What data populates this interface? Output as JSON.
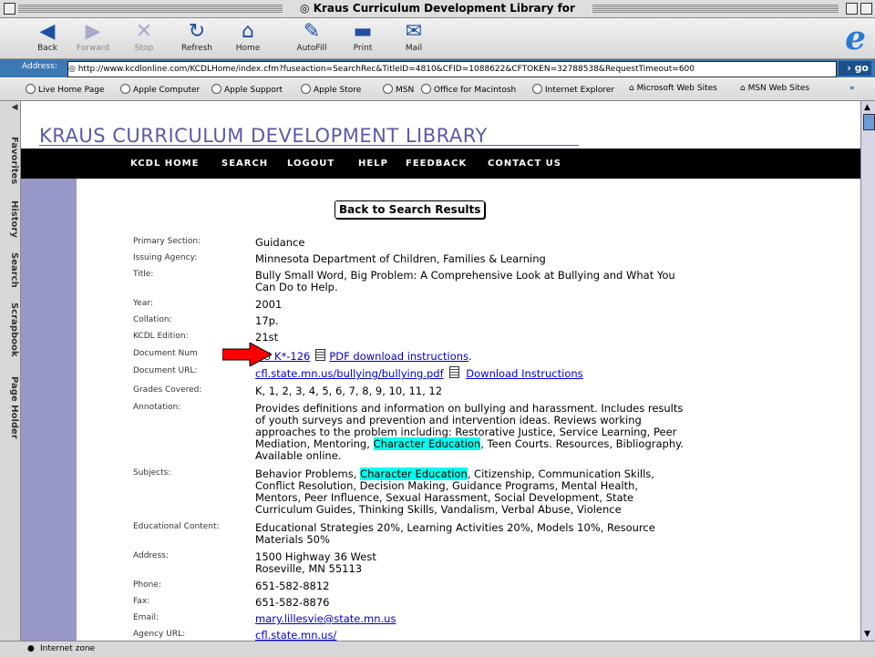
{
  "window": {
    "title": "Kraus Curriculum Development Library for educ..."
  },
  "toolbar": {
    "buttons": [
      {
        "label": "Back",
        "icon": "back-arrow-icon"
      },
      {
        "label": "Forward",
        "icon": "forward-arrow-icon"
      },
      {
        "label": "Stop",
        "icon": "stop-icon"
      },
      {
        "label": "Refresh",
        "icon": "refresh-icon"
      },
      {
        "label": "Home",
        "icon": "home-icon"
      },
      {
        "label": "AutoFill",
        "icon": "autofill-icon"
      },
      {
        "label": "Print",
        "icon": "print-icon"
      },
      {
        "label": "Mail",
        "icon": "mail-icon"
      }
    ]
  },
  "address": {
    "label": "Address:",
    "url": "http://www.kcdlonline.com/KCDLHome/index.cfm?fuseaction=SearchRec&TitleID=4810&CFID=1088622&CFTOKEN=32788538&RequestTimeout=600",
    "go_label": "go"
  },
  "favorites": [
    "Live Home Page",
    "Apple Computer",
    "Apple Support",
    "Apple Store",
    "MSN",
    "Office for Macintosh",
    "Internet Explorer",
    "Microsoft Web Sites",
    "MSN Web Sites"
  ],
  "sidetabs": [
    "Favorites",
    "History",
    "Search",
    "Scrapbook",
    "Page Holder"
  ],
  "status": {
    "text": "Internet zone"
  },
  "page": {
    "brand": "KRAUS CURRICULUM DEVELOPMENT LIBRARY",
    "nav": [
      "KCDL HOME",
      "SEARCH",
      "LOGOUT",
      "HELP",
      "FEEDBACK",
      "CONTACT US"
    ],
    "back_button": "Back to Search Results",
    "record": {
      "primary_section": {
        "label": "Primary Section:",
        "value": "Guidance"
      },
      "issuing_agency": {
        "label": "Issuing Agency:",
        "value": "Minnesota Department of Children, Families & Learning"
      },
      "title": {
        "label": "Title:",
        "value": "Bully Small Word, Big Problem: A Comprehensive Look at Bullying and What You Can Do to Help."
      },
      "year": {
        "label": "Year:",
        "value": "2001"
      },
      "collation": {
        "label": "Collation:",
        "value": "17p."
      },
      "edition": {
        "label": "KCDL Edition:",
        "value": "21st"
      },
      "document_number": {
        "label": "Document Num",
        "value": "GU K*-126",
        "instructions": "PDF download instructions",
        "trailing": "."
      },
      "document_url": {
        "label": "Document URL:",
        "value": "cfl.state.mn.us/bullying/bullying.pdf",
        "instructions": "Download Instructions"
      },
      "grades": {
        "label": "Grades Covered:",
        "value": "K, 1, 2, 3, 4, 5, 6, 7, 8, 9, 10, 11, 12"
      },
      "annotation": {
        "label": "Annotation:",
        "before": "Provides definitions and information on bullying and harassment. Includes results of youth surveys and prevention and intervention ideas. Reviews working approaches to the problem including: Restorative Justice, Service Learning, Peer Mediation, Mentoring, ",
        "highlight": "Character Education",
        "after": ", Teen Courts. Resources, Bibliography. Available online."
      },
      "subjects": {
        "label": "Subjects:",
        "before": "Behavior Problems, ",
        "highlight": "Character Education",
        "after": ", Citizenship, Communication Skills, Conflict Resolution, Decision Making, Guidance Programs, Mental Health, Mentors, Peer Influence, Sexual Harassment, Social Development, State Curriculum Guides, Thinking Skills, Vandalism, Verbal Abuse, Violence"
      },
      "educational_content": {
        "label": "Educational Content:",
        "value": "Educational Strategies 20%, Learning Activities 20%, Models 10%, Resource Materials 50%"
      },
      "address": {
        "label": "Address:",
        "line1": "1500 Highway 36 West",
        "line2": "Roseville,  MN  55113"
      },
      "phone": {
        "label": "Phone:",
        "value": "651-582-8812"
      },
      "fax": {
        "label": "Fax:",
        "value": "651-582-8876"
      },
      "email": {
        "label": "Email:",
        "value": "mary.lillesvie@state.mn.us"
      },
      "agency_url": {
        "label": "Agency URL:",
        "value": "cfl.state.mn.us/"
      }
    }
  },
  "colors": {
    "brand": "#5a5aa8",
    "highlight": "#00ffee",
    "address_bar": "#3c78b4",
    "arrow": "#ff0000"
  }
}
